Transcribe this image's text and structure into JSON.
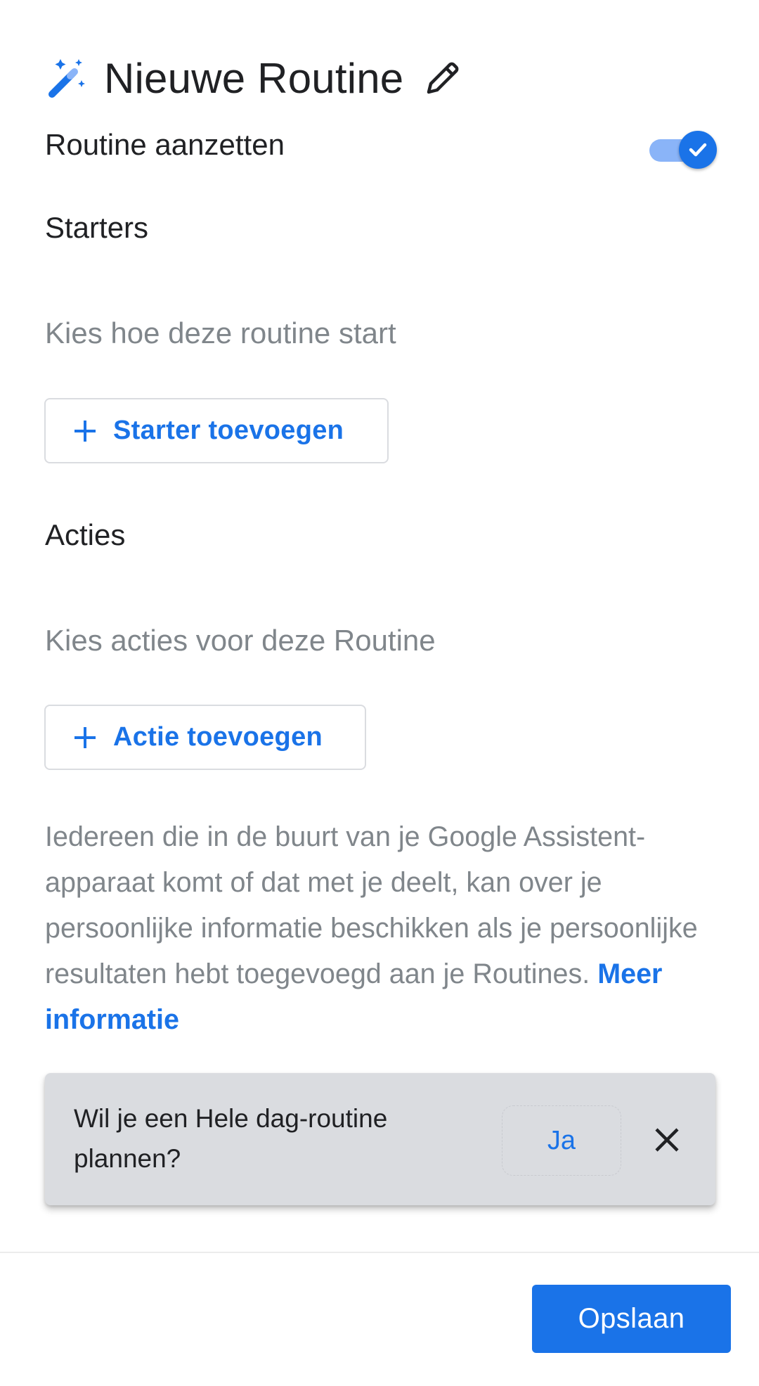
{
  "header": {
    "title": "Nieuwe Routine",
    "leading_icon": "magic-wand-icon",
    "edit_icon": "pencil-icon"
  },
  "toggle": {
    "label": "Routine aanzetten",
    "enabled": true
  },
  "starters": {
    "heading": "Starters",
    "hint": "Kies hoe deze routine start",
    "button_label": "Starter toevoegen"
  },
  "actions": {
    "heading": "Acties",
    "hint": "Kies acties voor deze Routine",
    "button_label": "Actie toevoegen"
  },
  "disclaimer": {
    "text": "Iedereen die in de buurt van je Google Assistent-apparaat komt of dat met je deelt, kan over je persoonlijke informatie beschikken als je persoonlijke resultaten hebt toegevoegd aan je Routines.",
    "link": "Meer informatie"
  },
  "snackbar": {
    "message": "Wil je een Hele dag-routine plannen?",
    "action_label": "Ja",
    "close_icon": "close-icon"
  },
  "footer": {
    "save_label": "Opslaan"
  },
  "colors": {
    "accent": "#1a73e8",
    "toggle_track": "#8ab4f8",
    "hint_text": "#80868b",
    "snackbar_bg": "#dadce0"
  }
}
